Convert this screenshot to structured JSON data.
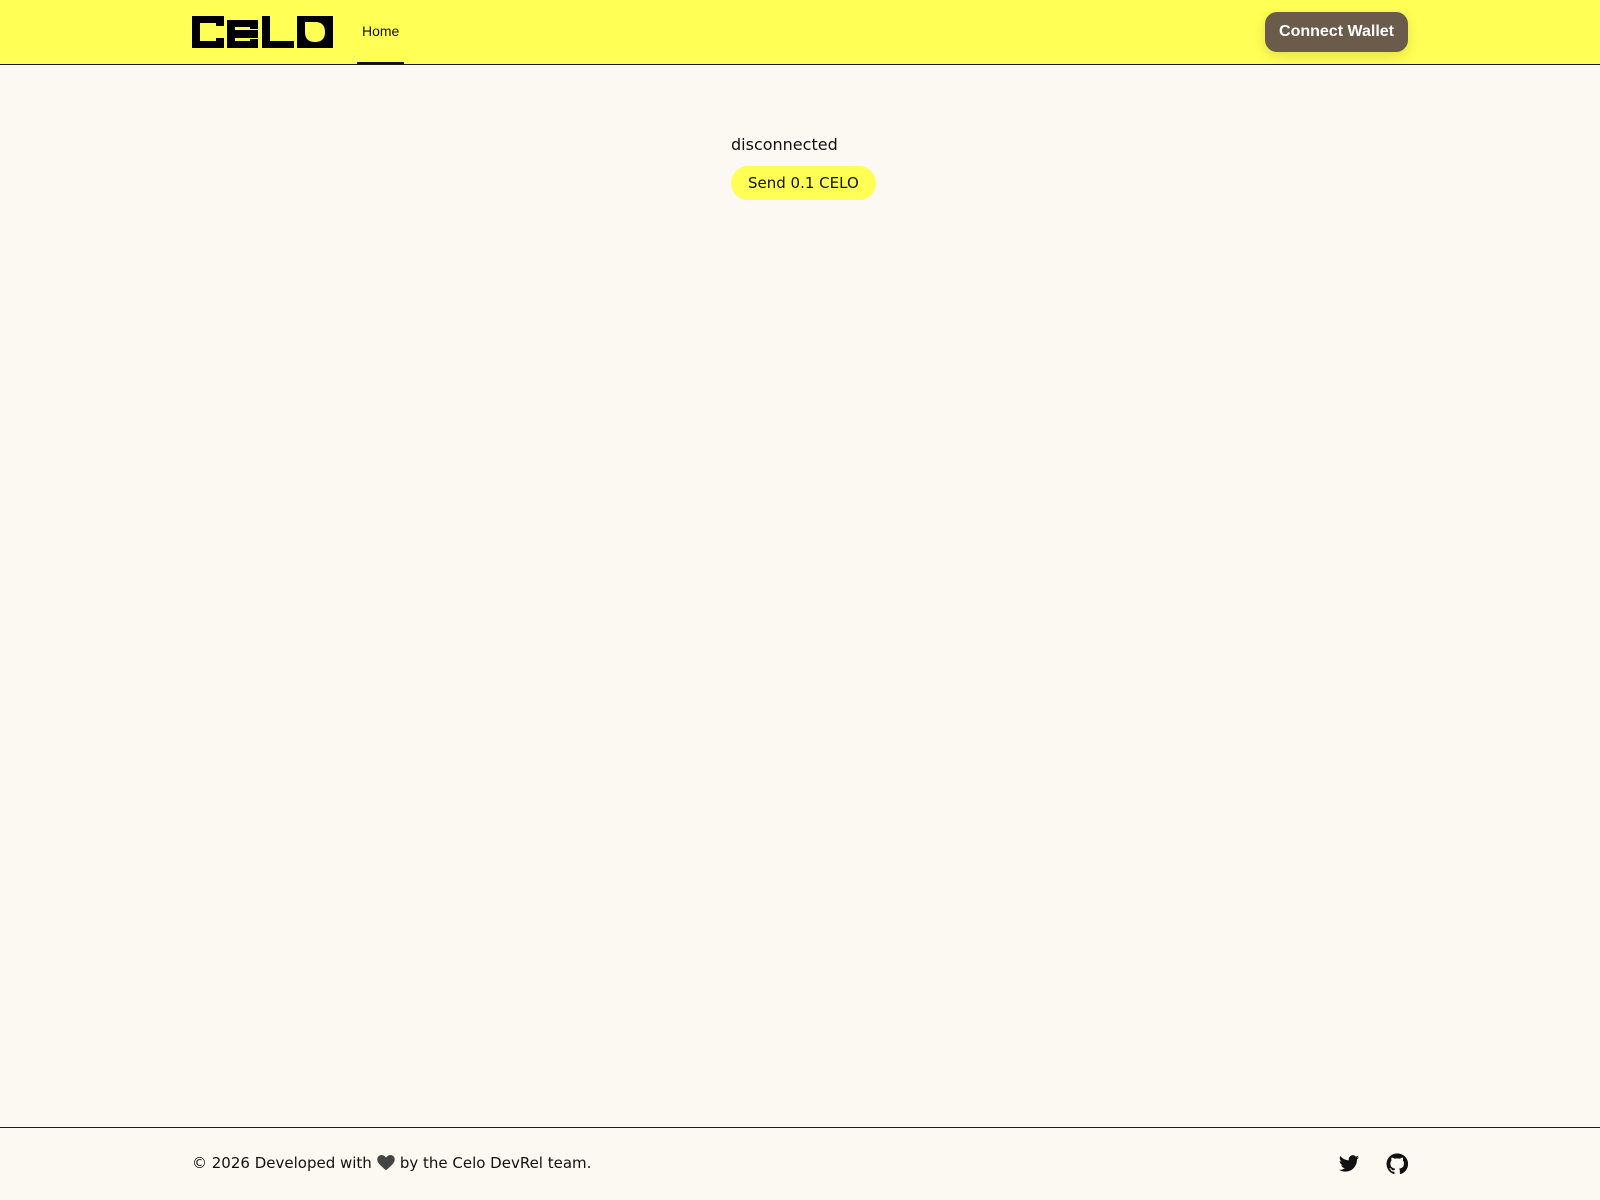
{
  "header": {
    "logo_text": "celo",
    "nav": [
      {
        "label": "Home",
        "active": true
      }
    ],
    "connect_label": "Connect Wallet"
  },
  "main": {
    "status": "disconnected",
    "send_label": "Send 0.1 CELO"
  },
  "footer": {
    "copyright_prefix": "© 2026 Developed with",
    "copyright_suffix": "by the Celo DevRel team.",
    "social": [
      "twitter-icon",
      "github-icon"
    ]
  },
  "colors": {
    "header_bg": "#ffff55",
    "page_bg": "#fcf8f2",
    "connect_bg": "#6b5b4a",
    "send_bg": "#ffff55"
  }
}
